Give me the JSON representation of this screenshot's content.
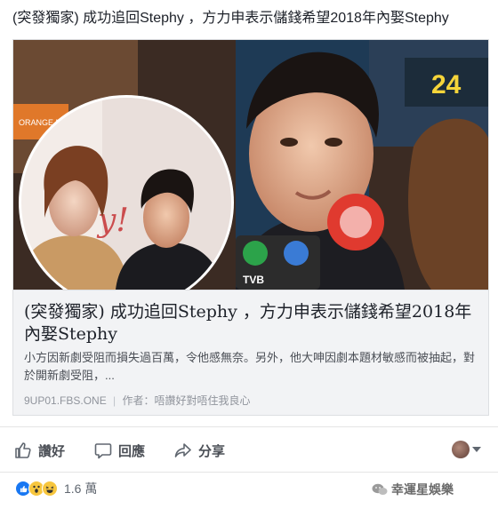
{
  "post": {
    "title": "(突發獨家) 成功追回Stephy ，方力申表示儲錢希望2018年內娶Stephy"
  },
  "link_preview": {
    "title": "(突發獨家) 成功追回Stephy ，方力申表示儲錢希望2018年內娶Stephy",
    "description": "小方因新劇受阻而損失過百萬，令他感無奈。另外，他大呻因劇本題材敏感而被抽起，對於開新劇受阻，...",
    "domain": "9UP01.FBS.ONE",
    "separator": "|",
    "author": "作者：唔讚好對唔住我良心",
    "image_texts": {
      "orange_news": "ORANGE NEWS",
      "backdrop_number": "24",
      "mic_logo": "TVB"
    }
  },
  "actions": {
    "like": "讚好",
    "comment": "回應",
    "share": "分享"
  },
  "reactions": {
    "count": "1.6 萬"
  },
  "watermark": {
    "text": "幸運星娛樂"
  },
  "colors": {
    "border": "#dddfe2",
    "preview_bg": "#f2f3f5",
    "like_blue": "#1877f2",
    "wow_yellow": "#f7c63e"
  }
}
